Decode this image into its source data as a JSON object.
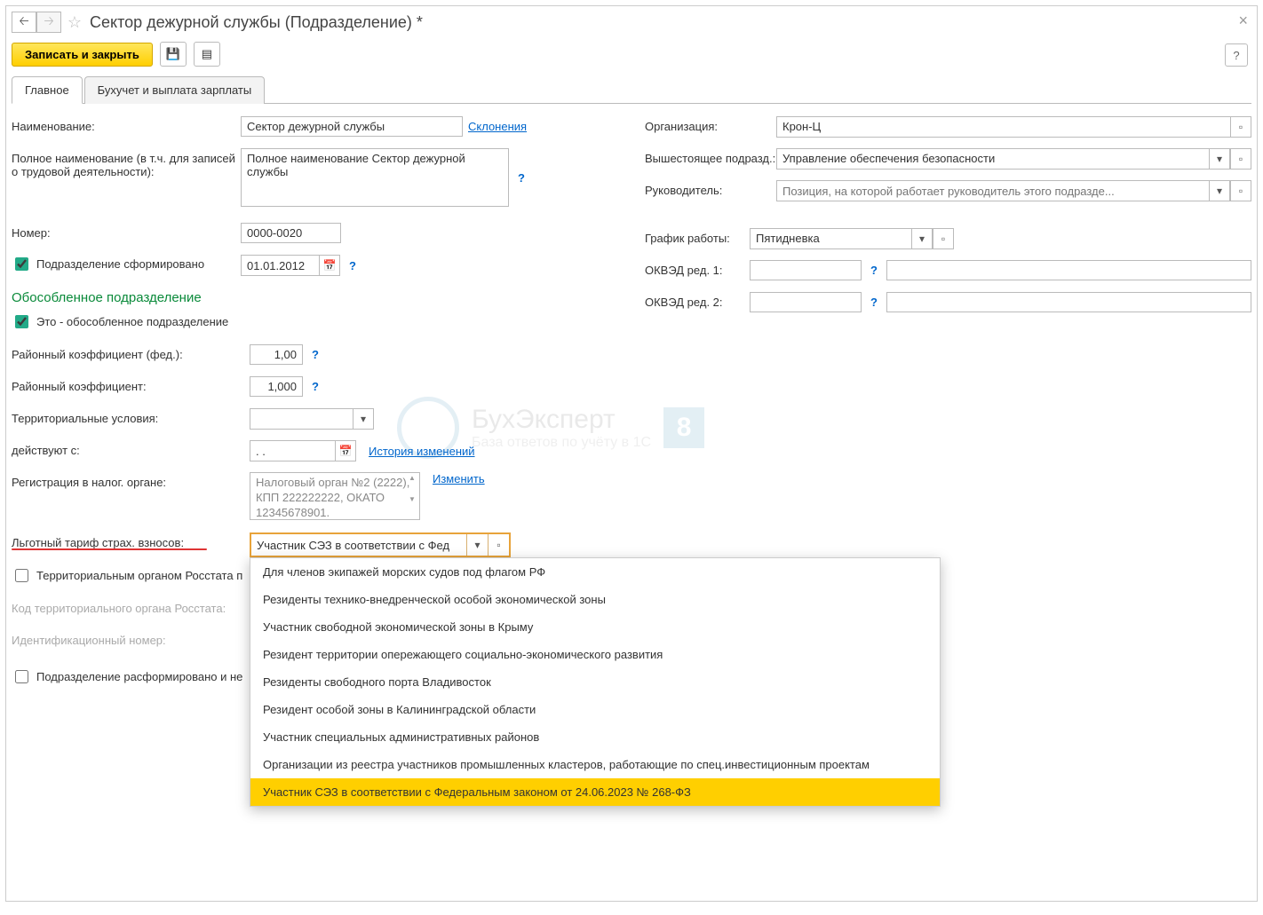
{
  "header": {
    "title": "Сектор дежурной службы (Подразделение) *"
  },
  "toolbar": {
    "save_close": "Записать и закрыть"
  },
  "tabs": {
    "main": "Главное",
    "acc": "Бухучет и выплата зарплаты"
  },
  "labels": {
    "name": "Наименование:",
    "fullname": "Полное наименование (в т.ч. для записей о трудовой деятельности):",
    "number": "Номер:",
    "formed": "Подразделение сформировано",
    "sep_section": "Обособленное подразделение",
    "is_sep": "Это - обособленное подразделение",
    "district_fed": "Районный коэффициент (фед.):",
    "district": "Районный коэффициент:",
    "terr": "Территориальные условия:",
    "valid_from": "действуют с:",
    "tax_reg": "Регистрация в налог. органе:",
    "tariff": "Льготный тариф страх. взносов:",
    "rosstat_chk": "Территориальным органом Росстата п",
    "rosstat_code": "Код территориального органа Росстата:",
    "ident": "Идентификационный номер:",
    "disbanded": "Подразделение расформировано и не",
    "org": "Организация:",
    "parent": "Вышестоящее подразд.:",
    "head": "Руководитель:",
    "schedule": "График работы:",
    "okved1": "ОКВЭД ред. 1:",
    "okved2": "ОКВЭД ред. 2:"
  },
  "links": {
    "decl": "Склонения",
    "history": "История изменений",
    "change": "Изменить"
  },
  "values": {
    "name": "Сектор дежурной службы",
    "fullname": "Полное наименование Сектор дежурной службы",
    "number": "0000-0020",
    "formed_date": "01.01.2012",
    "district_fed": "1,00",
    "district": "1,000",
    "valid_from": ". .",
    "tax_reg": "Налоговый орган №2 (2222), КПП 222222222, ОКАТО 12345678901.",
    "tariff_selected": "Участник СЭЗ в соответствии с Фед",
    "org": "Крон-Ц",
    "parent": "Управление обеспечения безопасности",
    "head_placeholder": "Позиция, на которой работает руководитель этого подразде...",
    "schedule": "Пятидневка"
  },
  "dropdown": {
    "items": [
      "Для членов экипажей морских судов под флагом РФ",
      "Резиденты технико-внедренческой особой экономической зоны",
      "Участник свободной экономической зоны в Крыму",
      "Резидент территории опережающего социально-экономического развития",
      "Резиденты свободного порта Владивосток",
      "Резидент особой зоны в Калининградской области",
      "Участник специальных административных районов",
      "Организации из реестра участников промышленных кластеров, работающие по спец.инвестиционным проектам",
      "Участник СЭЗ в соответствии с Федеральным законом от 24.06.2023 № 268-ФЗ"
    ],
    "selected_index": 8
  },
  "watermark": {
    "text": "БухЭксперт",
    "sub": "База ответов по учёту в 1С",
    "badge": "8"
  }
}
